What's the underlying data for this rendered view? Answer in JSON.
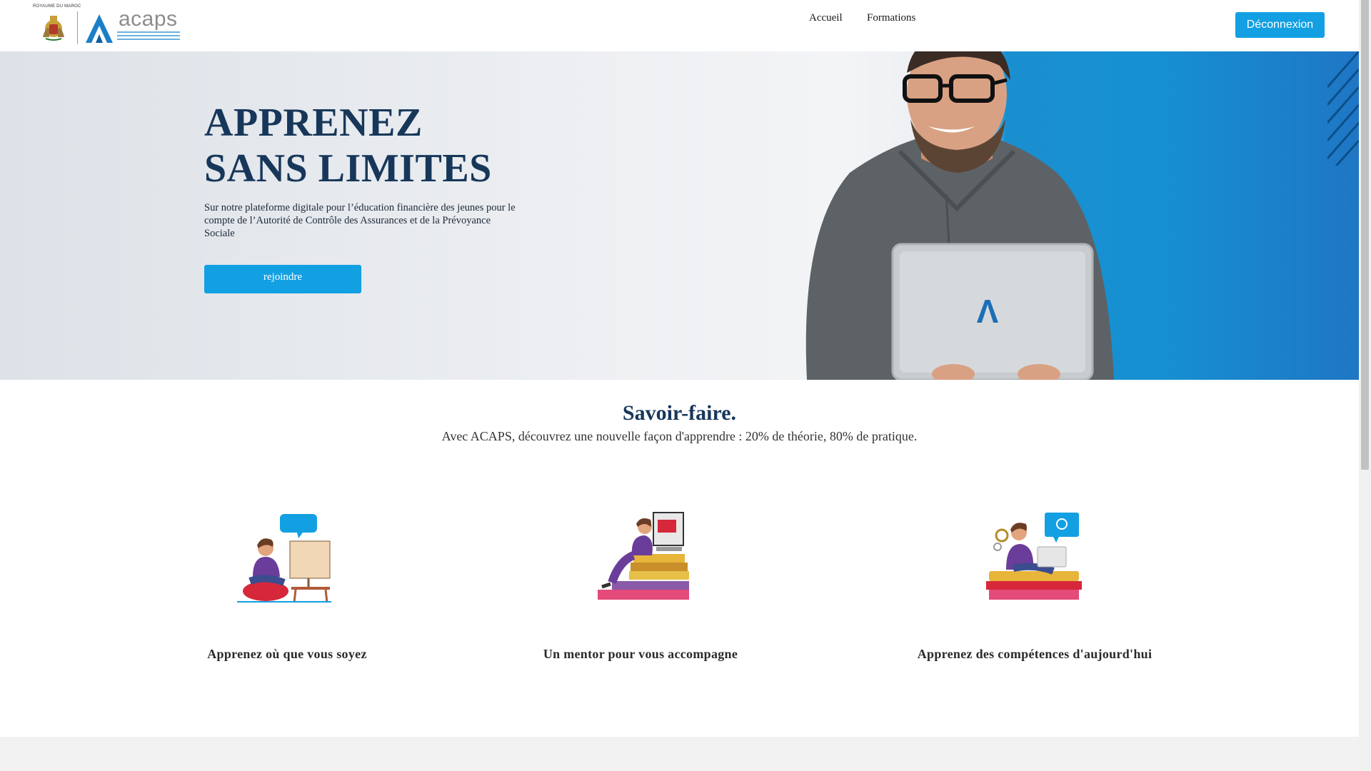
{
  "header": {
    "crest_label": "ROYAUME DU MAROC",
    "brand": "acaps",
    "nav": [
      {
        "label": "Accueil"
      },
      {
        "label": "Formations"
      }
    ],
    "logout_label": "Déconnexion"
  },
  "hero": {
    "title_line1": "APPRENEZ",
    "title_line2": "SANS LIMITES",
    "text": "Sur notre plateforme digitale pour l’éducation financière des jeunes pour le compte de l’Autorité de Contrôle des Assurances et de la Prévoyance Sociale",
    "cta_label": "rejoindre",
    "laptop_mark": "Λ"
  },
  "savoir": {
    "title": "Savoir-faire.",
    "subtitle": "Avec ACAPS, découvrez une nouvelle façon d'apprendre : 20% de théorie, 80% de pratique."
  },
  "features": [
    {
      "label": "Apprenez où que vous soyez",
      "icon": "person-at-computer-illustration"
    },
    {
      "label": "Un mentor pour vous accompagne",
      "icon": "person-on-books-illustration"
    },
    {
      "label": "Apprenez des compétences d'aujourd'hui",
      "icon": "person-with-laptop-illustration"
    }
  ],
  "colors": {
    "accent": "#12a0e3",
    "navy": "#17375a",
    "hero_blue": "#1690d2"
  }
}
